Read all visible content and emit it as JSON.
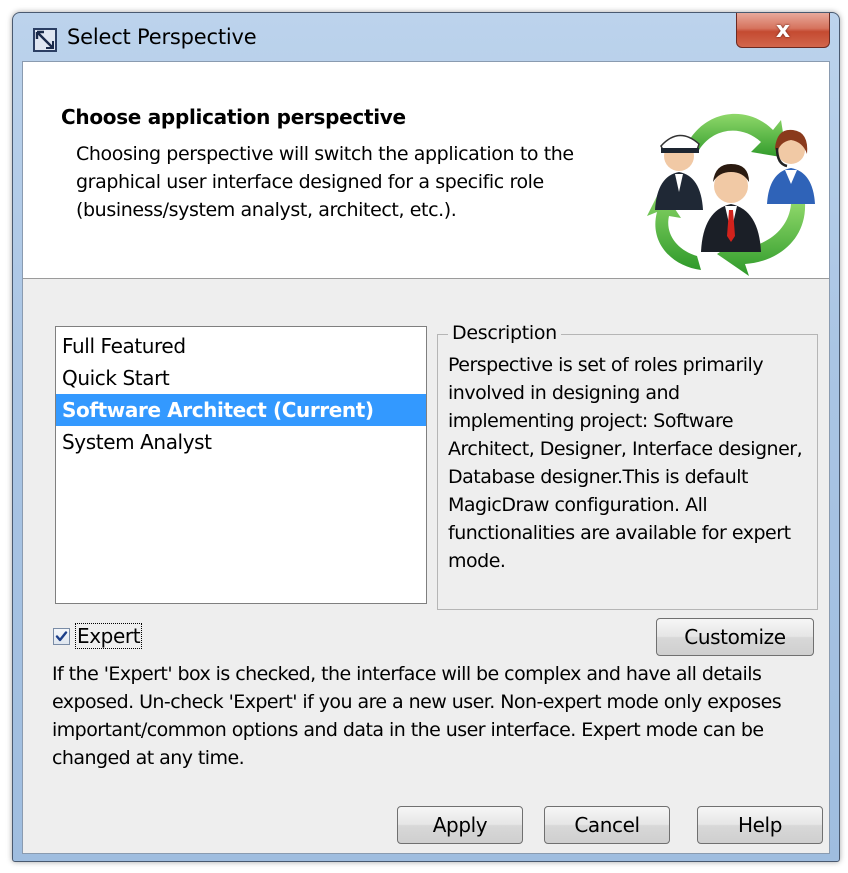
{
  "window": {
    "title": "Select Perspective",
    "close_label": "x"
  },
  "header": {
    "title": "Choose application perspective",
    "description": "Choosing perspective will switch the application to the graphical user interface designed for a specific role (business/system analyst, architect, etc.)."
  },
  "perspectives": {
    "items": [
      {
        "label": "Full Featured",
        "selected": false
      },
      {
        "label": "Quick Start",
        "selected": false
      },
      {
        "label": "Software Architect (Current)",
        "selected": true
      },
      {
        "label": "System Analyst",
        "selected": false
      }
    ]
  },
  "description": {
    "legend": "Description",
    "text": "Perspective is set of roles primarily involved in designing and implementing project: Software Architect, Designer, Interface designer, Database designer.This is default MagicDraw configuration. All functionalities are available for expert mode."
  },
  "expert": {
    "label": "Expert",
    "checked": true
  },
  "customize_label": "Customize",
  "info_text": "If the 'Expert' box is checked, the interface will be complex and have all details exposed. Un-check 'Expert' if you are a new user. Non-expert mode only exposes important/common options and data in the user interface. Expert mode can be changed at any time.",
  "buttons": {
    "apply": "Apply",
    "cancel": "Cancel",
    "help": "Help"
  },
  "colors": {
    "selection": "#3399ff",
    "dialog_bg": "#eeeeee",
    "close_button": "#c44a31"
  },
  "icons": {
    "app": "magicdraw-app-icon",
    "header_art": "perspective-people-cycle-icon",
    "close": "close-icon",
    "check": "check-icon"
  }
}
